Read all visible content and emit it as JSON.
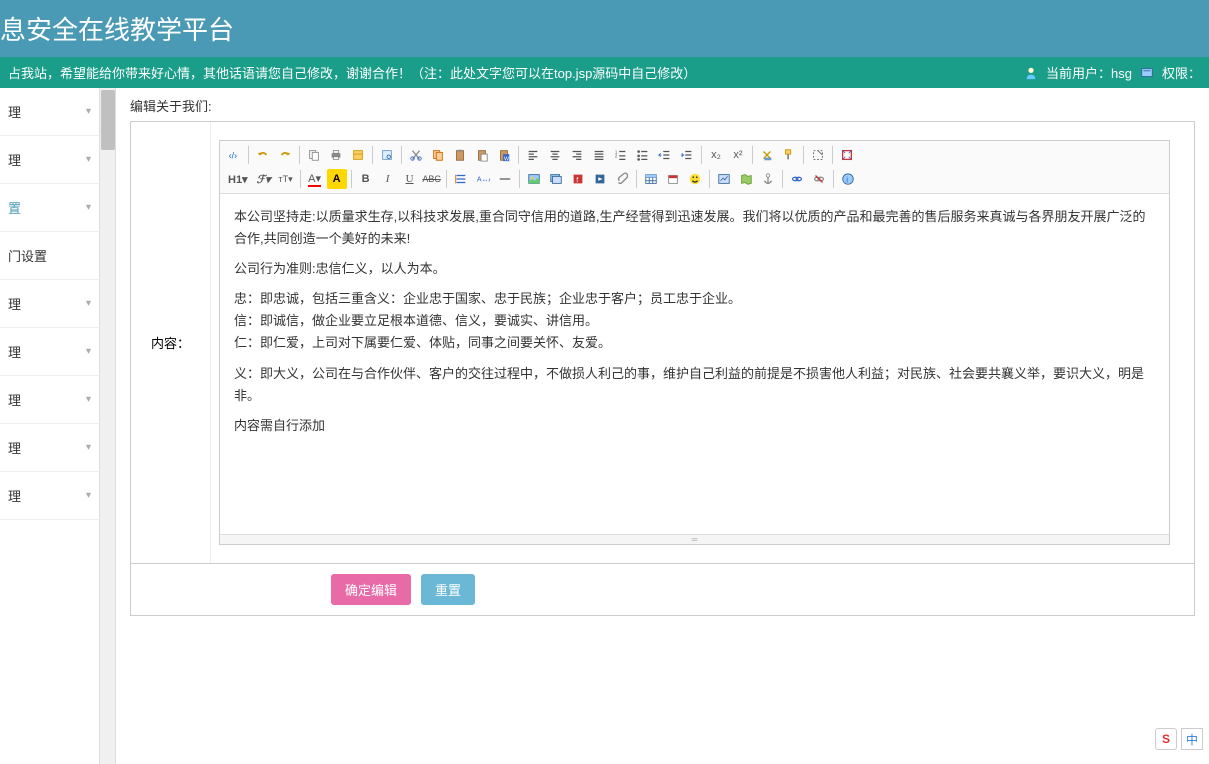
{
  "header": {
    "title": "息安全在线教学平台"
  },
  "subheader": {
    "message": "占我站，希望能给你带来好心情，其他话语请您自己修改，谢谢合作！（注：此处文字您可以在top.jsp源码中自己修改）",
    "user_label": "当前用户：",
    "user_name": "hsg",
    "perm_label": "权限："
  },
  "sidebar": {
    "items": [
      {
        "label": "理"
      },
      {
        "label": "理"
      },
      {
        "label": "置"
      },
      {
        "label": "门设置"
      },
      {
        "label": "理"
      },
      {
        "label": "理"
      },
      {
        "label": "理"
      },
      {
        "label": "理"
      },
      {
        "label": "理"
      }
    ]
  },
  "page": {
    "title": "编辑关于我们:"
  },
  "editor": {
    "label": "内容：",
    "toolbar": {
      "h1": "H1▾",
      "f": "ℱ▾",
      "tt": "тТ▾",
      "a": "A▾",
      "a_hl": "A",
      "b": "B",
      "i": "I",
      "u": "U",
      "abc": "ABC",
      "sub": "x₂",
      "sup": "x²"
    },
    "content": {
      "p1": "    本公司坚持走:以质量求生存,以科技求发展,重合同守信用的道路,生产经营得到迅速发展。我们将以优质的产品和最完善的售后服务来真诚与各界朋友开展广泛的合作,共同创造一个美好的未来!",
      "p2": "公司行为准则:忠信仁义，以人为本。",
      "p3": "忠：即忠诚，包括三重含义：企业忠于国家、忠于民族；企业忠于客户；员工忠于企业。",
      "p4": "信：即诚信，做企业要立足根本道德、信义，要诚实、讲信用。",
      "p5": "仁：即仁爱，上司对下属要仁爱、体贴，同事之间要关怀、友爱。",
      "p6": "义：即大义，公司在与合作伙伴、客户的交往过程中，不做损人利己的事，维护自己利益的前提是不损害他人利益；对民族、社会要共襄义举，要识大义，明是非。",
      "p7": "内容需自行添加"
    }
  },
  "buttons": {
    "submit": "确定编辑",
    "reset": "重置"
  },
  "ime": {
    "s": "S",
    "zh": "中"
  }
}
